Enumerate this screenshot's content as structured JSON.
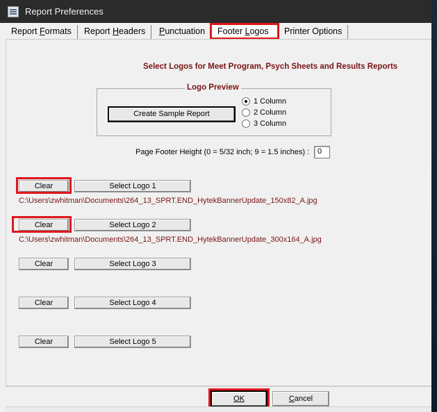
{
  "window": {
    "title": "Report Preferences"
  },
  "tabs": [
    {
      "label_pre": "Report ",
      "label_u": "F",
      "label_post": "ormats"
    },
    {
      "label_pre": "Report ",
      "label_u": "H",
      "label_post": "eaders"
    },
    {
      "label_pre": "",
      "label_u": "P",
      "label_post": "unctuation"
    },
    {
      "label_pre": "Footer ",
      "label_u": "L",
      "label_post": "ogos"
    },
    {
      "label_pre": "Printer Options",
      "label_u": "",
      "label_post": ""
    }
  ],
  "heading": "Select Logos for Meet Program, Psych Sheets and Results Reports",
  "preview": {
    "title": "Logo Preview",
    "sample_button": "Create Sample Report",
    "columns": [
      "1 Column",
      "2 Column",
      "3 Column"
    ],
    "selected_column": "1 Column"
  },
  "footer_height": {
    "label": "Page Footer Height (0 = 5/32 inch; 9 = 1.5 inches) :",
    "value": "0"
  },
  "logos": [
    {
      "clear": "Clear",
      "select": "Select Logo 1",
      "path": "C:\\Users\\zwhitman\\Documents\\264_13_SPRT.END_HytekBannerUpdate_150x82_A.jpg"
    },
    {
      "clear": "Clear",
      "select": "Select Logo 2",
      "path": "C:\\Users\\zwhitman\\Documents\\264_13_SPRT.END_HytekBannerUpdate_300x164_A.jpg"
    },
    {
      "clear": "Clear",
      "select": "Select Logo 3",
      "path": ""
    },
    {
      "clear": "Clear",
      "select": "Select Logo 4",
      "path": ""
    },
    {
      "clear": "Clear",
      "select": "Select Logo 5",
      "path": ""
    }
  ],
  "buttons": {
    "ok": "OK",
    "cancel_u": "C",
    "cancel_rest": "ancel"
  },
  "colors": {
    "highlight": "#e0161e",
    "accent_text": "#7a1414",
    "titlebar": "#2b2b2b"
  }
}
